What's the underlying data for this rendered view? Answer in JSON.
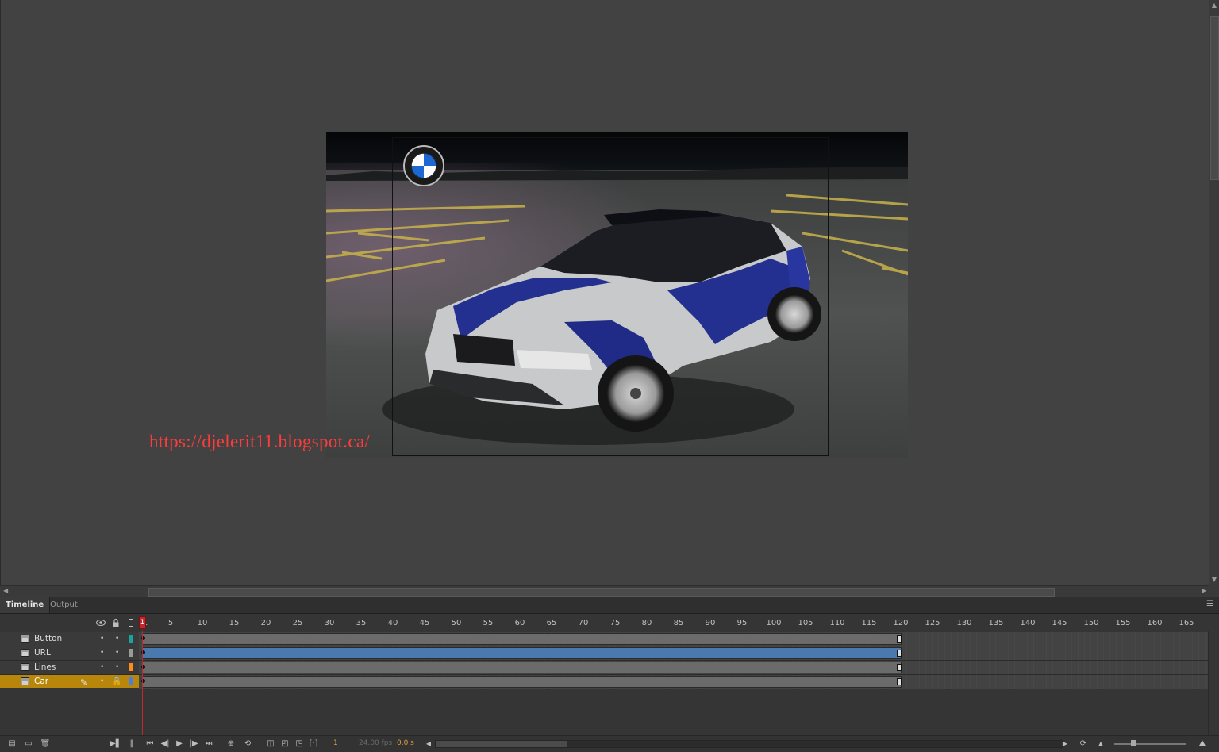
{
  "stage": {
    "url_overlay": "https://djelerit11.blogspot.ca/"
  },
  "panel": {
    "tabs": [
      {
        "label": "Timeline",
        "active": true
      },
      {
        "label": "Output",
        "active": false
      }
    ]
  },
  "timeline": {
    "ruler_ticks": [
      "1",
      "5",
      "10",
      "15",
      "20",
      "25",
      "30",
      "35",
      "40",
      "45",
      "50",
      "55",
      "60",
      "65",
      "70",
      "75",
      "80",
      "85",
      "90",
      "95",
      "100",
      "105",
      "110",
      "115",
      "120",
      "125",
      "130",
      "135",
      "140",
      "145",
      "150",
      "155",
      "160",
      "165"
    ],
    "playhead_frame": "1",
    "layers": [
      {
        "name": "Button",
        "color": "#1aa3a3",
        "selected": false
      },
      {
        "name": "URL",
        "color": "#9a9a9a",
        "selected": false
      },
      {
        "name": "Lines",
        "color": "#ff8c1a",
        "selected": false
      },
      {
        "name": "Car",
        "color": "#4a7fdc",
        "selected": true
      }
    ],
    "last_frame": 120,
    "selected_span_layer": "URL"
  },
  "status": {
    "current_frame": "1",
    "fps": "24.00 fps",
    "time": "0.0 s"
  },
  "icons": {
    "eye": "eye-icon",
    "lock": "lock-icon",
    "outline": "outline-icon"
  }
}
